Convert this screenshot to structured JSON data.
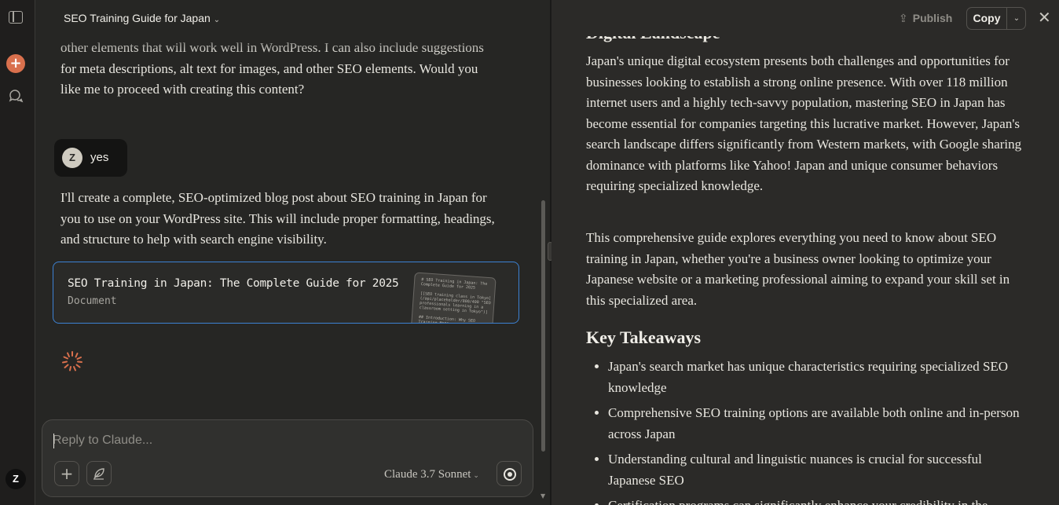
{
  "rail": {
    "user_initial": "Z"
  },
  "chat": {
    "title": "SEO Training Guide for Japan",
    "assistant_prev": "other elements that will work well in WordPress. I can also include suggestions for meta descriptions, alt text for images, and other SEO elements. Would you like me to proceed with creating this content?",
    "user_message": {
      "initial": "Z",
      "text": "yes"
    },
    "assistant_reply": "I'll create a complete, SEO-optimized blog post about SEO training in Japan for you to use on your WordPress site. This will include proper formatting, headings, and structure to help with search engine visibility.",
    "artifact": {
      "title": "SEO Training in Japan: The Complete Guide for 2025",
      "type": "Document",
      "thumb_text": "# SEO Training in Japan: The\nComplete Guide for 2025\n\n[[SEO training class in Tokyo]\n(/api/placeholder/800/400 \"SEO\nprofessionals learning in a\nclassroom setting in Tokyo\")]\n\n## Introduction: Why SEO\nTraining Matters"
    },
    "composer": {
      "placeholder": "Reply to Claude...",
      "model": "Claude 3.7 Sonnet"
    }
  },
  "document": {
    "toolbar": {
      "publish": "Publish",
      "copy": "Copy"
    },
    "cut_heading": "Digital Landscape",
    "p1": "Japan's unique digital ecosystem presents both challenges and opportunities for businesses looking to establish a strong online presence. With over 118 million internet users and a highly tech-savvy population, mastering SEO in Japan has become essential for companies targeting this lucrative market. However, Japan's search landscape differs significantly from Western markets, with Google sharing dominance with platforms like Yahoo! Japan and unique consumer behaviors requiring specialized knowledge.",
    "p2": "This comprehensive guide explores everything you need to know about SEO training in Japan, whether you're a business owner looking to optimize your Japanese website or a marketing professional aiming to expand your skill set in this specialized area.",
    "key_takeaways_heading": "Key Takeaways",
    "takeaways": [
      "Japan's search market has unique characteristics requiring specialized SEO knowledge",
      "Comprehensive SEO training options are available both online and in-person across Japan",
      "Understanding cultural and linguistic nuances is crucial for successful Japanese SEO",
      "Certification programs can significantly enhance your credibility in the"
    ]
  },
  "colors": {
    "accent": "#d9704d",
    "artifact_border": "#3c82d4",
    "background": "#262624"
  }
}
